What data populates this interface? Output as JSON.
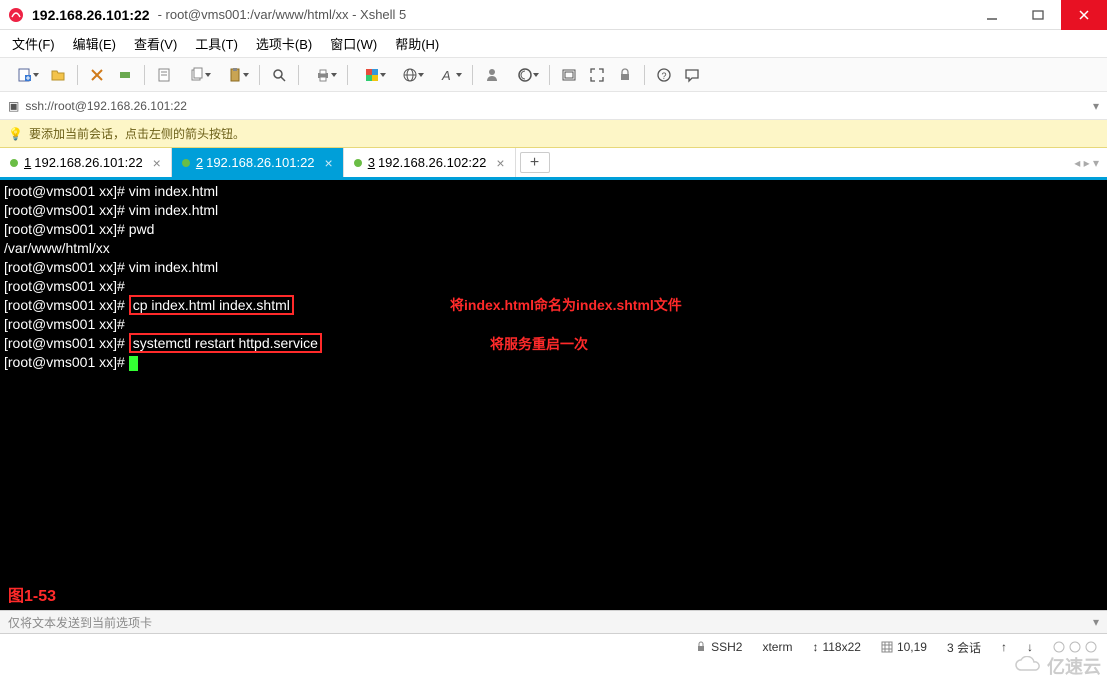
{
  "window": {
    "title_left": "192.168.26.101:22",
    "title_right": "root@vms001:/var/www/html/xx - Xshell 5"
  },
  "menu": {
    "file": "文件(F)",
    "edit": "编辑(E)",
    "view": "查看(V)",
    "tools": "工具(T)",
    "tabs": "选项卡(B)",
    "window": "窗口(W)",
    "help": "帮助(H)"
  },
  "address": {
    "url": "ssh://root@192.168.26.101:22"
  },
  "hint": {
    "text": "要添加当前会话，点击左侧的箭头按钮。"
  },
  "tabs": [
    {
      "idx": "1",
      "label": "192.168.26.101:22",
      "active": false
    },
    {
      "idx": "2",
      "label": "192.168.26.101:22",
      "active": true
    },
    {
      "idx": "3",
      "label": "192.168.26.102:22",
      "active": false
    }
  ],
  "terminal": {
    "prompt_open": "[",
    "prompt_user": "root",
    "prompt_at": "@",
    "prompt_host": "vms001",
    "prompt_dir": "xx",
    "prompt_close": "]#",
    "lines": [
      {
        "cmd": "vim index.html"
      },
      {
        "cmd": "vim index.html"
      },
      {
        "cmd": "pwd"
      },
      {
        "out": "/var/www/html/xx"
      },
      {
        "cmd": "vim index.html"
      },
      {
        "cmd": ""
      },
      {
        "cmd": "cp index.html index.shtml",
        "boxed": true
      },
      {
        "cmd": ""
      },
      {
        "cmd": "systemctl restart httpd.service",
        "boxed": true
      },
      {
        "cmd": "",
        "cursor": true
      }
    ],
    "ann1": "将index.html命名为index.shtml文件",
    "ann2": "将服务重启一次",
    "figure": "图1-53"
  },
  "inputbar": {
    "placeholder": "仅将文本发送到当前选项卡"
  },
  "status": {
    "proto": "SSH2",
    "term": "xterm",
    "size": "118x22",
    "cursor": "10,19",
    "sessions": "3 会话",
    "resize_icon": "↕",
    "net1": "↑",
    "net2": "↓"
  },
  "watermark": "亿速云"
}
